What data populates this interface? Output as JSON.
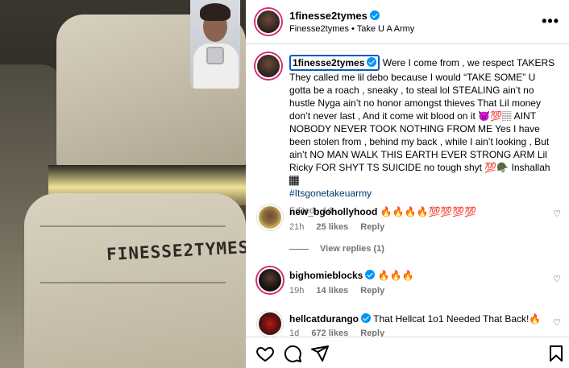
{
  "post": {
    "username": "1finesse2tymes",
    "subtitle_account": "Finesse2tymes",
    "subtitle_separator": "•",
    "subtitle_audio": "Take U A Army"
  },
  "caption": {
    "username": "1finesse2tymes",
    "text": "Were I come from , we respect TAKERS They called me lil debo because I would “TAKE SOME” U gotta be a roach , sneaky , to steal lol STEALING ain’t no hustle Nyga ain’t no honor amongst thieves That Lil money don’t never last , And it come wit blood on it 😈💯🏽 AINT NOBODY NEVER TOOK NOTHING FROM ME Yes I have been stolen from , behind my back , while I ain’t looking , But ain’t NO MAN WALK THIS EARTH EVER STRONG ARM Lil Ricky FOR SHYT TS SUICIDE no tough shyt 💯🪖 Inshallah 🏾",
    "hashtag": "#Itsgonetakeuarmy",
    "meta": "Edited · 1d"
  },
  "media": {
    "headrest_text": "FINESSE2TYMES"
  },
  "comments": [
    {
      "username": "new_bgohollyhood",
      "verified": false,
      "text": "🔥🔥🔥🔥💯💯💯💯",
      "age": "21h",
      "likes": "25 likes",
      "reply": "Reply",
      "view_replies": "View replies (1)"
    },
    {
      "username": "bighomieblocks",
      "verified": true,
      "text": "🔥🔥🔥",
      "age": "19h",
      "likes": "14 likes",
      "reply": "Reply"
    },
    {
      "username": "hellcatdurango",
      "verified": true,
      "text": "That Hellcat 1o1 Needed That Back!🔥",
      "age": "1d",
      "likes": "672 likes",
      "reply": "Reply"
    }
  ],
  "icons": {
    "more": "more-dots-icon",
    "like": "heart-icon",
    "comment": "comment-icon",
    "share": "share-icon",
    "save": "bookmark-icon"
  },
  "colors": {
    "verified": "#0095f6",
    "hashtag": "#00376b",
    "muted": "#737373"
  }
}
